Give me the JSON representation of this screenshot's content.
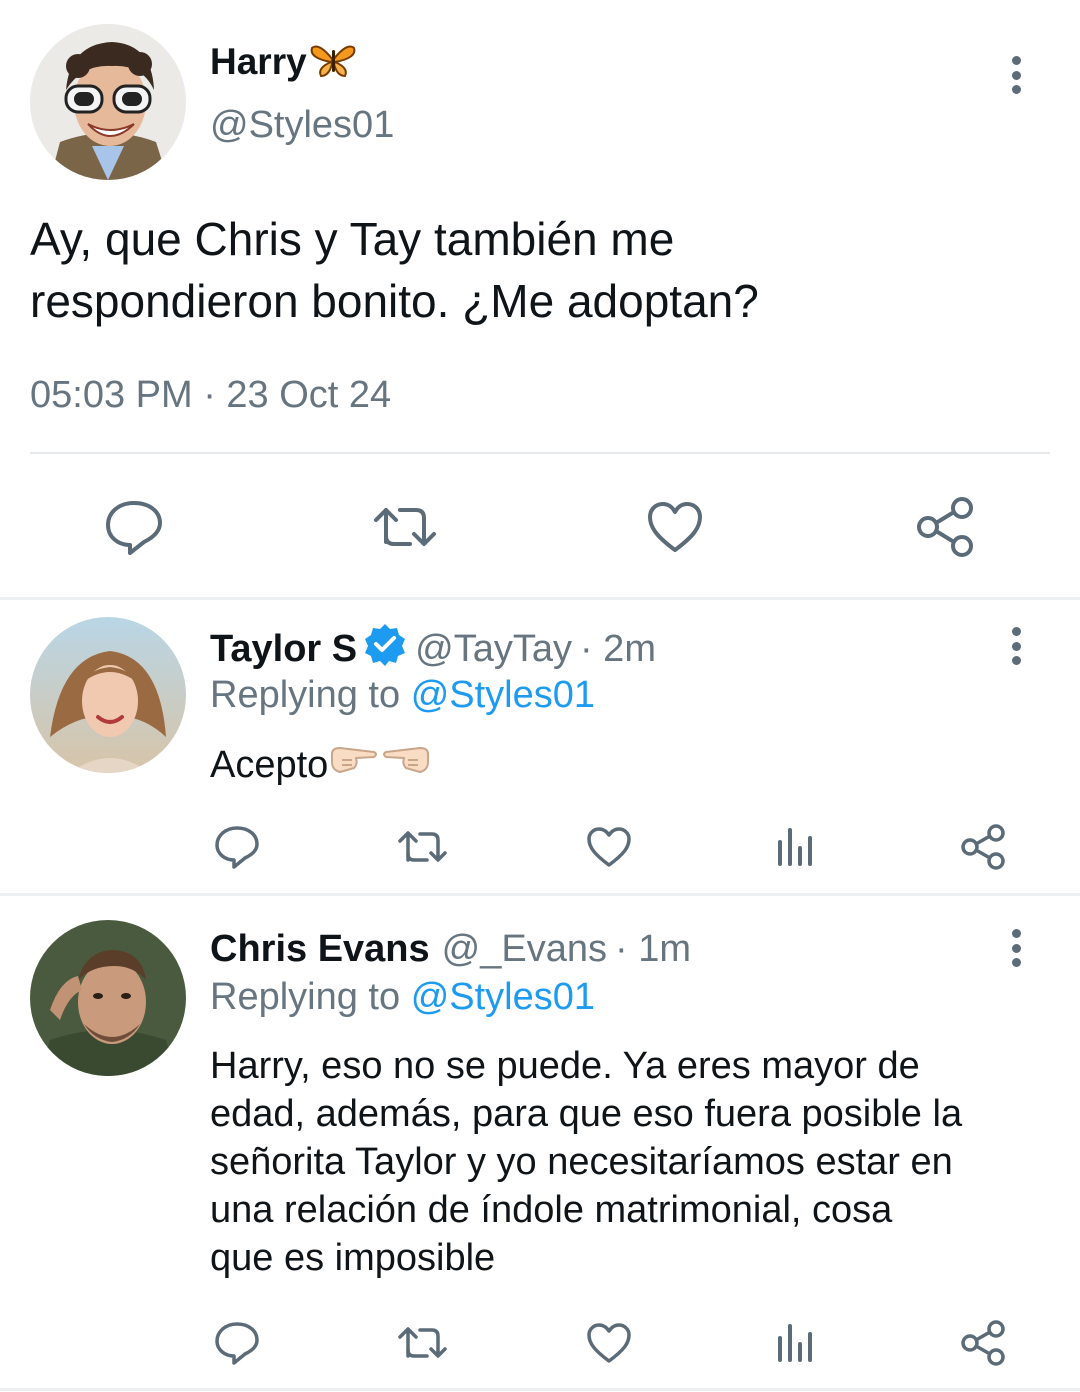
{
  "main_tweet": {
    "author_name": "Harry",
    "handle": "@Styles01",
    "text_line1": "Ay, que Chris y Tay también me",
    "text_line2": "respondieron bonito. ¿Me adoptan?",
    "timestamp": "05:03 PM · 23 Oct 24",
    "name_emoji_icon": "butterfly-icon"
  },
  "replies": [
    {
      "author_name": "Taylor S",
      "verified": true,
      "handle": "@TayTay",
      "time": "· 2m",
      "replying_prefix": "Replying to",
      "replying_to": "@Styles01",
      "text": "Acepto",
      "emoji_icons": [
        "pointing-right-hand-icon",
        "pointing-left-hand-icon"
      ]
    },
    {
      "author_name": "Chris Evans",
      "verified": false,
      "handle": "@_Evans",
      "time": "· 1m",
      "replying_prefix": "Replying to",
      "replying_to": "@Styles01",
      "text_lines": [
        "Harry, eso no se puede. Ya eres mayor de",
        "edad, además, para que eso fuera posible la",
        "señorita Taylor y yo necesitaríamos estar en",
        "una relación de índole matrimonial, cosa",
        "que es imposible"
      ]
    }
  ],
  "colors": {
    "accent": "#1d9bf0",
    "muted_text": "#66757f",
    "icon": "#5b6b77",
    "divider": "#eceef0"
  }
}
